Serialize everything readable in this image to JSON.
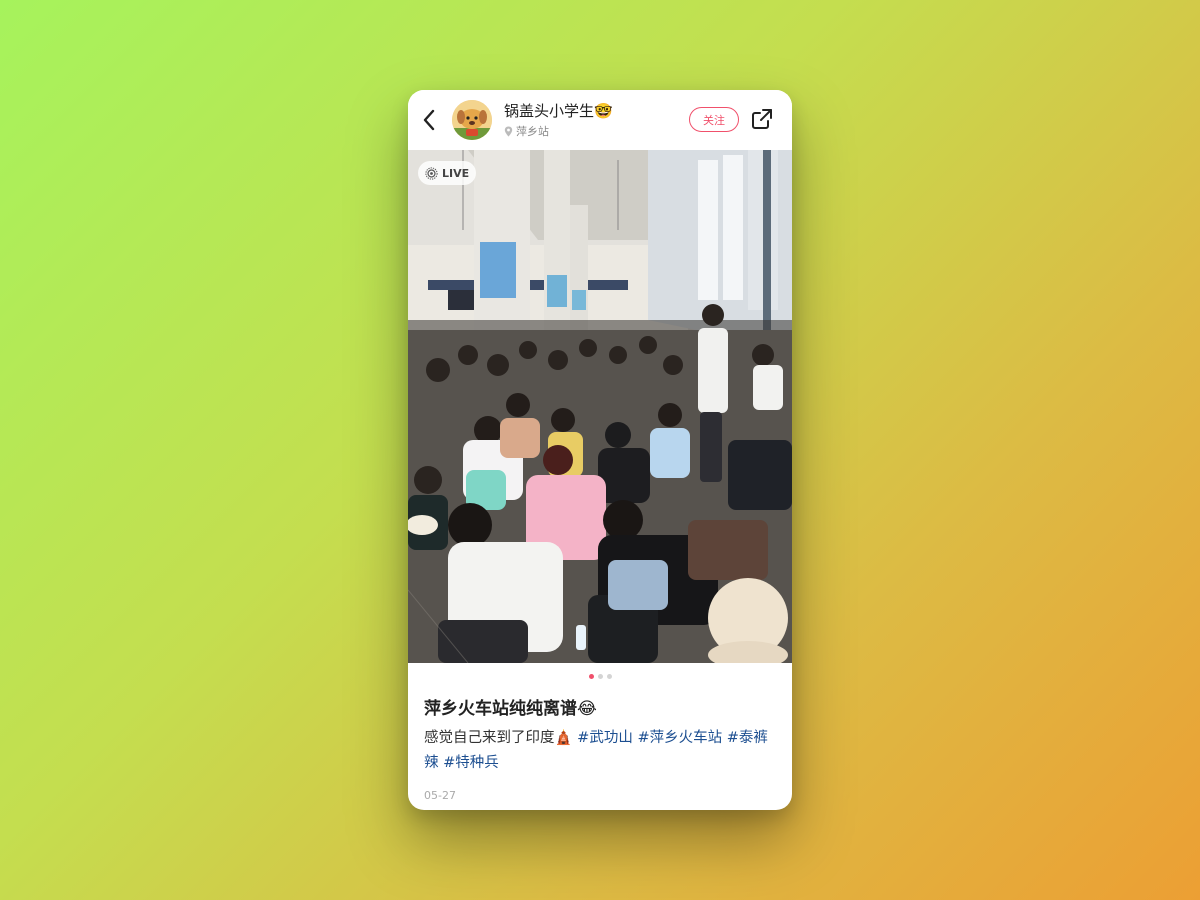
{
  "header": {
    "username": "锅盖头小学生🤓",
    "location": "萍乡站",
    "follow_label": "关注"
  },
  "icons": {
    "back": "chevron-left-icon",
    "share": "share-icon",
    "location": "location-pin-icon",
    "live": "live-photo-icon"
  },
  "photo": {
    "live_label": "LIVE",
    "description": "Crowded train station waiting hall with many young people sitting on the floor"
  },
  "carousel": {
    "current": 1,
    "total": 3
  },
  "post": {
    "title": "萍乡火车站纯纯离谱😂",
    "text": "感觉自己来到了印度🛕",
    "tags": [
      "#武功山",
      "#萍乡火车站",
      "#泰裤辣",
      "#特种兵"
    ],
    "date": "05-27"
  },
  "colors": {
    "accent": "#f0506b",
    "tag": "#1d4f91",
    "bg_start": "#a6f35c",
    "bg_end": "#ec9f34"
  }
}
